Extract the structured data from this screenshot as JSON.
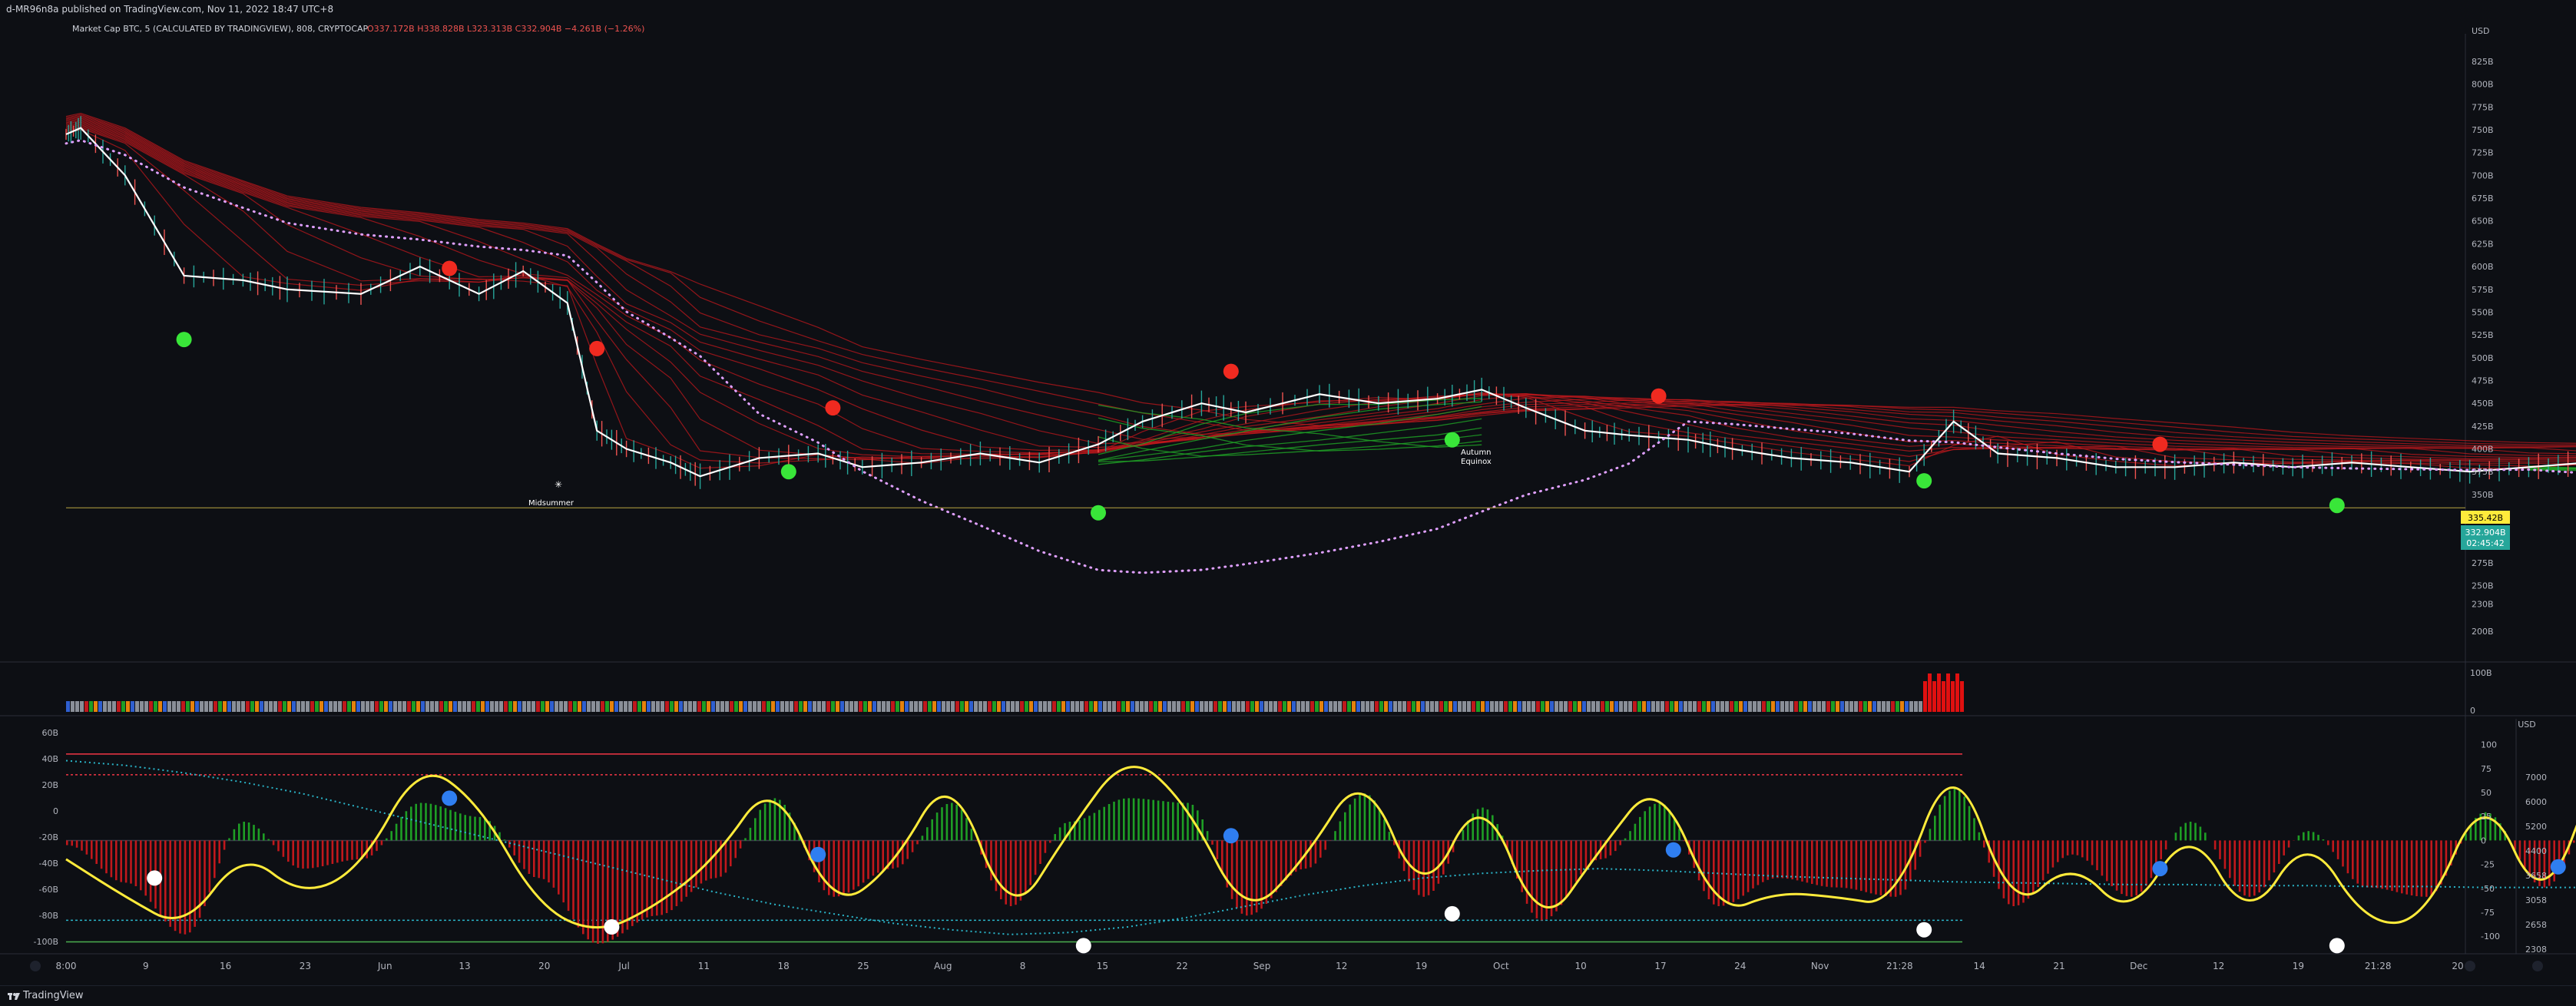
{
  "header": {
    "publish_line": "d-MR96n8a published on TradingView.com, Nov 11, 2022 18:47 UTC+8"
  },
  "legend": {
    "symbol": "Market Cap BTC, 5 (CALCULATED BY TRADINGVIEW), 808, CRYPTOCAP",
    "ohlc": "O337.172B H338.828B L323.313B C332.904B −4.261B (−1.26%)"
  },
  "colors": {
    "background": "#0d0f14",
    "bull": "#26a69a",
    "bear": "#ef5350",
    "price_line": "#ffffff",
    "ribbon_bear": "#c0181c",
    "ribbon_bull": "#1e9e25",
    "dot_green": "#39e639",
    "dot_red": "#f02a20",
    "dot_blue": "#2f7ef0",
    "dot_white": "#ffffff",
    "osc_line": "#ffeb3b",
    "osc_cyan": "#2ab5c9",
    "label_yellow": "#ffeb3b",
    "label_teal": "#26a69a"
  },
  "price_axis": {
    "unit": "USD",
    "ticks": [
      "825B",
      "800B",
      "775B",
      "750B",
      "725B",
      "700B",
      "675B",
      "650B",
      "625B",
      "600B",
      "575B",
      "550B",
      "525B",
      "500B",
      "475B",
      "450B",
      "425B",
      "400B",
      "375B",
      "350B",
      "325B",
      "300B",
      "275B",
      "250B",
      "230B",
      "200B"
    ],
    "tick_values": [
      825,
      800,
      775,
      750,
      725,
      700,
      675,
      650,
      625,
      600,
      575,
      550,
      525,
      500,
      475,
      450,
      425,
      400,
      375,
      350,
      325,
      300,
      275,
      250,
      230,
      200
    ],
    "level_label": "335.42B",
    "last_price_label": "332.904B",
    "countdown_label": "02:45:42"
  },
  "volume_axis": {
    "ticks": [
      "100B",
      "0"
    ]
  },
  "osc_axis_left": {
    "ticks": [
      "60B",
      "40B",
      "20B",
      "0",
      "-20B",
      "-40B",
      "-60B",
      "-80B",
      "-100B"
    ],
    "tick_values": [
      60,
      40,
      20,
      0,
      -20,
      -40,
      -60,
      -80,
      -100
    ]
  },
  "osc_axis_mid": {
    "unit": "USD",
    "ticks": [
      "100",
      "75",
      "50",
      "25",
      "0",
      "-25",
      "-50",
      "-75",
      "-100"
    ],
    "tick_values": [
      100,
      75,
      50,
      25,
      0,
      -25,
      -50,
      -75,
      -100
    ]
  },
  "osc_axis_right": {
    "ticks": [
      "7000",
      "6000",
      "5200",
      "4400",
      "3658",
      "3058",
      "2658",
      "2308"
    ]
  },
  "time_axis": {
    "labels": [
      "8:00",
      "9",
      "16",
      "23",
      "Jun",
      "13",
      "20",
      "Jul",
      "11",
      "18",
      "25",
      "Aug",
      "8",
      "15",
      "22",
      "Sep",
      "12",
      "19",
      "Oct",
      "10",
      "17",
      "24",
      "Nov",
      "21:28",
      "14",
      "21",
      "Dec",
      "12",
      "19",
      "21:28",
      "20"
    ]
  },
  "annotations": {
    "midsummer": "Midsummer",
    "autumn1": "Autumn",
    "autumn2": "Equinox"
  },
  "footer": {
    "brand": "TradingView"
  },
  "chart_data": {
    "type": "line",
    "title": "Market Cap BTC, 5 (CALCULATED BY TRADINGVIEW), 808, CRYPTOCAP",
    "ylabel": "USD",
    "ylim": [
      200,
      830
    ],
    "x": [
      "May 8",
      "May 9",
      "May 12",
      "May 16",
      "May 20",
      "May 23",
      "May 28",
      "Jun 1",
      "Jun 5",
      "Jun 8",
      "Jun 11",
      "Jun 13",
      "Jun 15",
      "Jun 18",
      "Jun 20",
      "Jun 24",
      "Jun 28",
      "Jul 1",
      "Jul 5",
      "Jul 9",
      "Jul 13",
      "Jul 17",
      "Jul 20",
      "Jul 24",
      "Jul 27",
      "Aug 1",
      "Aug 5",
      "Aug 9",
      "Aug 12",
      "Aug 15",
      "Aug 19",
      "Aug 22",
      "Aug 26",
      "Aug 29",
      "Sep 2",
      "Sep 6",
      "Sep 10",
      "Sep 13",
      "Sep 16",
      "Sep 20",
      "Sep 24",
      "Sep 28",
      "Oct 2",
      "Oct 6",
      "Oct 10",
      "Oct 14",
      "Oct 18",
      "Oct 22",
      "Oct 26",
      "Oct 30",
      "Nov 3",
      "Nov 6",
      "Nov 8",
      "Nov 10",
      "Nov 11"
    ],
    "series": [
      {
        "values": [
          745,
          752,
          700,
          590,
          585,
          575,
          570,
          600,
          570,
          595,
          560,
          420,
          400,
          385,
          370,
          390,
          395,
          380,
          385,
          395,
          385,
          405,
          430,
          450,
          440,
          460,
          450,
          455,
          465,
          445,
          420,
          415,
          410,
          400,
          390,
          385,
          375,
          430,
          395,
          390,
          380,
          380,
          385,
          380,
          385,
          380,
          375,
          380,
          385,
          390,
          400,
          405,
          395,
          330,
          333
        ]
      }
    ],
    "trend_dots": [
      {
        "date": "May 16",
        "value": 520,
        "color": "green"
      },
      {
        "date": "Jun 3",
        "value": 598,
        "color": "red"
      },
      {
        "date": "Jun 13",
        "value": 510,
        "color": "red"
      },
      {
        "date": "Jun 26",
        "value": 375,
        "color": "green"
      },
      {
        "date": "Jun 29",
        "value": 445,
        "color": "red"
      },
      {
        "date": "Jul 17",
        "value": 330,
        "color": "green"
      },
      {
        "date": "Jul 26",
        "value": 485,
        "color": "red"
      },
      {
        "date": "Aug 10",
        "value": 410,
        "color": "green"
      },
      {
        "date": "Aug 24",
        "value": 458,
        "color": "red"
      },
      {
        "date": "Sep 11",
        "value": 365,
        "color": "green"
      },
      {
        "date": "Sep 27",
        "value": 405,
        "color": "red"
      },
      {
        "date": "Oct 9",
        "value": 338,
        "color": "green"
      },
      {
        "date": "Oct 26",
        "value": 410,
        "color": "red"
      },
      {
        "date": "Nov 9",
        "value": 338,
        "color": "green"
      }
    ],
    "oscillator": {
      "ylim": [
        -110,
        105
      ],
      "upper_band": 92,
      "upper_dotted": 70,
      "lower_dotted": -85,
      "lower_band": -108,
      "x": [
        "May 8",
        "May 12",
        "May 16",
        "May 20",
        "May 24",
        "May 28",
        "Jun 1",
        "Jun 5",
        "Jun 9",
        "Jun 13",
        "Jun 17",
        "Jun 21",
        "Jun 25",
        "Jun 29",
        "Jul 3",
        "Jul 7",
        "Jul 11",
        "Jul 15",
        "Jul 19",
        "Jul 23",
        "Jul 27",
        "Jul 31",
        "Aug 4",
        "Aug 8",
        "Aug 12",
        "Aug 16",
        "Aug 20",
        "Aug 24",
        "Aug 28",
        "Sep 1",
        "Sep 5",
        "Sep 9",
        "Sep 13",
        "Sep 17",
        "Sep 21",
        "Sep 25",
        "Sep 29",
        "Oct 3",
        "Oct 7",
        "Oct 11",
        "Oct 15",
        "Oct 19",
        "Oct 23",
        "Oct 27",
        "Oct 31",
        "Nov 4",
        "Nov 8",
        "Nov 11"
      ],
      "signal": [
        -20,
        -60,
        -95,
        -10,
        -60,
        -30,
        85,
        40,
        -70,
        -100,
        -70,
        -20,
        70,
        -75,
        -30,
        80,
        -90,
        10,
        95,
        40,
        -85,
        -20,
        80,
        -70,
        60,
        -100,
        -10,
        70,
        -80,
        -55,
        -60,
        -70,
        100,
        -80,
        -20,
        -85,
        20,
        -90,
        10,
        -90,
        -85,
        60,
        -80,
        90,
        60,
        -80,
        -100,
        -65
      ],
      "histogram": [
        -5,
        -45,
        -100,
        20,
        -30,
        -20,
        40,
        25,
        -40,
        -110,
        -80,
        -40,
        45,
        -60,
        -30,
        40,
        -70,
        20,
        45,
        40,
        -80,
        -30,
        50,
        -60,
        35,
        -85,
        -20,
        40,
        -70,
        -40,
        -50,
        -60,
        55,
        -70,
        -15,
        -60,
        20,
        -60,
        10,
        -50,
        -60,
        30,
        -50,
        45,
        35,
        -40,
        -60,
        -75
      ],
      "cyan_baseline": [
        85,
        80,
        72,
        62,
        50,
        35,
        20,
        5,
        -10,
        -25,
        -40,
        -55,
        -68,
        -78,
        -88,
        -95,
        -100,
        -98,
        -92,
        -82,
        -70,
        -58,
        -48,
        -40,
        -35,
        -32,
        -30,
        -32,
        -35,
        -38,
        -40,
        -42,
        -44,
        -45,
        -46,
        -47,
        -47,
        -48,
        -48,
        -49,
        -49,
        -50,
        -50,
        -50,
        -51,
        -51,
        -52,
        -53
      ],
      "markers": [
        {
          "date": "May 14",
          "value": -40,
          "color": "white"
        },
        {
          "date": "Jun 3",
          "value": 45,
          "color": "blue"
        },
        {
          "date": "Jun 14",
          "value": -92,
          "color": "white"
        },
        {
          "date": "Jun 28",
          "value": -15,
          "color": "blue"
        },
        {
          "date": "Jul 16",
          "value": -112,
          "color": "white"
        },
        {
          "date": "Jul 26",
          "value": 5,
          "color": "blue"
        },
        {
          "date": "Aug 10",
          "value": -78,
          "color": "white"
        },
        {
          "date": "Aug 25",
          "value": -10,
          "color": "blue"
        },
        {
          "date": "Sep 11",
          "value": -95,
          "color": "white"
        },
        {
          "date": "Sep 27",
          "value": -30,
          "color": "blue"
        },
        {
          "date": "Oct 9",
          "value": -112,
          "color": "white"
        },
        {
          "date": "Oct 24",
          "value": -28,
          "color": "blue"
        },
        {
          "date": "Nov 9",
          "value": -110,
          "color": "white"
        }
      ]
    }
  }
}
